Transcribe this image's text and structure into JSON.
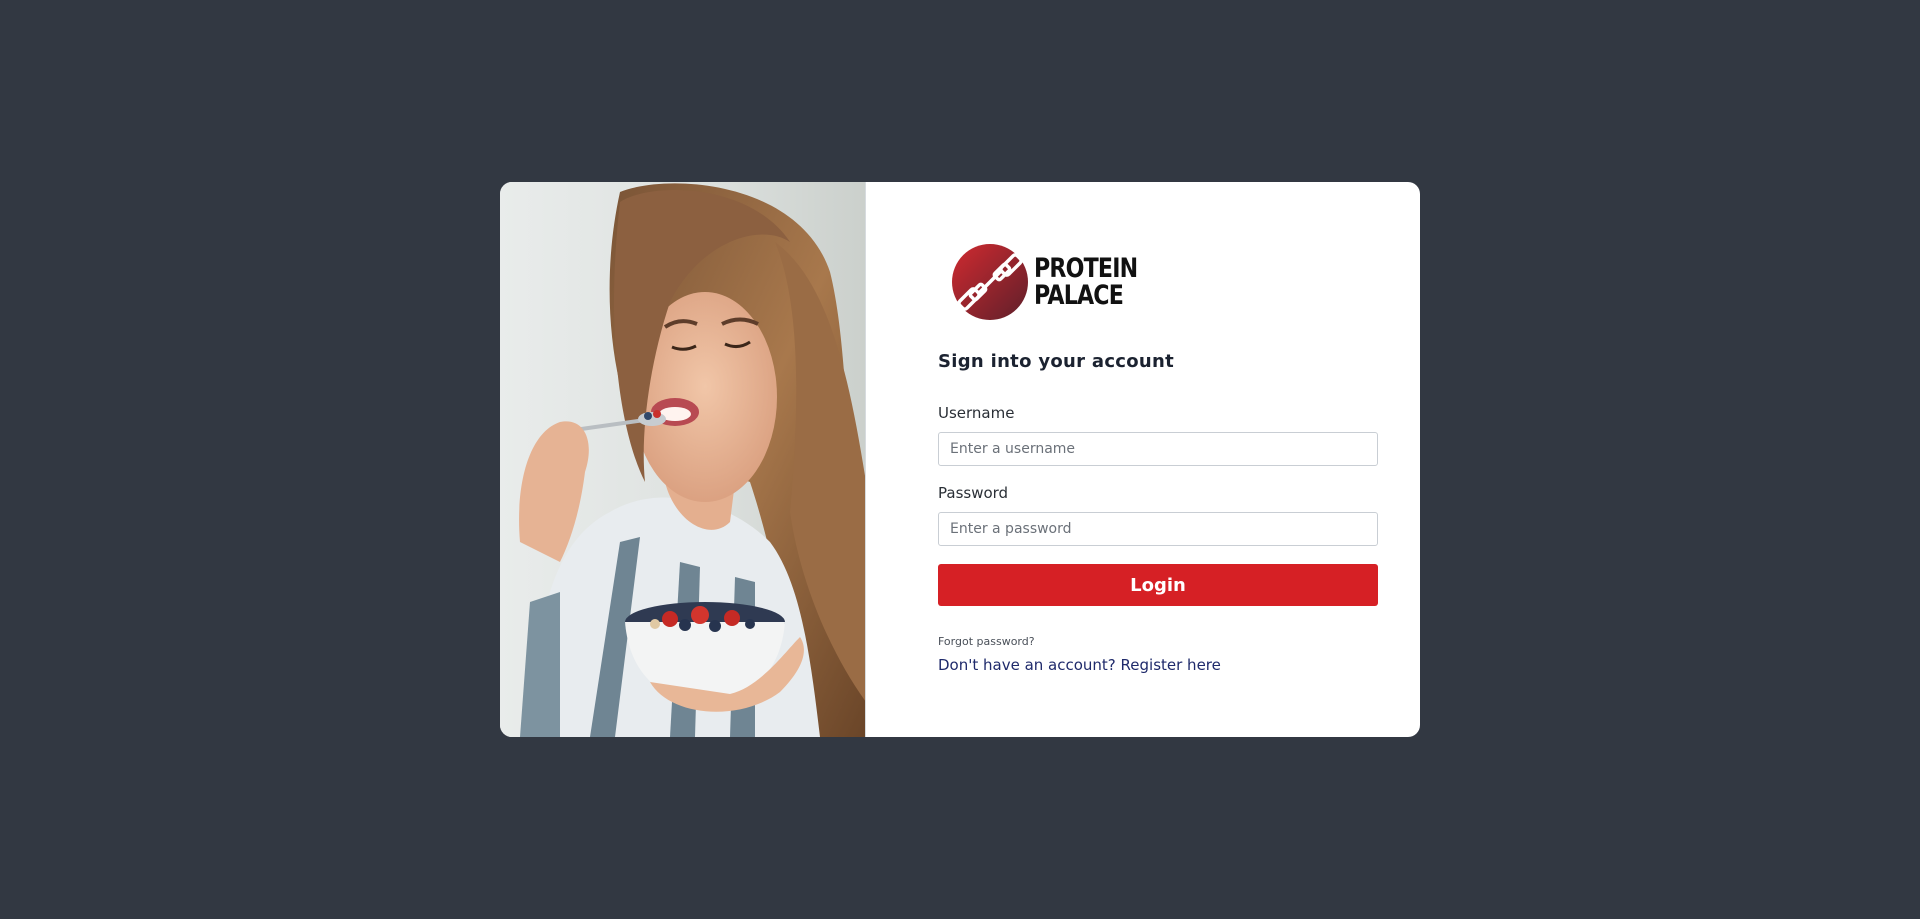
{
  "brand": {
    "line1": "PROTEIN",
    "line2": "PALACE",
    "logo_icon": "dumbbell-icon",
    "logo_color": "#c4262d"
  },
  "form": {
    "heading": "Sign into your account",
    "username_label": "Username",
    "username_placeholder": "Enter a username",
    "password_label": "Password",
    "password_placeholder": "Enter a password",
    "login_label": "Login",
    "forgot_label": "Forgot password?",
    "register_label": "Don't have an account? Register here"
  },
  "colors": {
    "background": "#323842",
    "card": "#ffffff",
    "primary_button": "#d62025",
    "link": "#1f2a6b"
  }
}
